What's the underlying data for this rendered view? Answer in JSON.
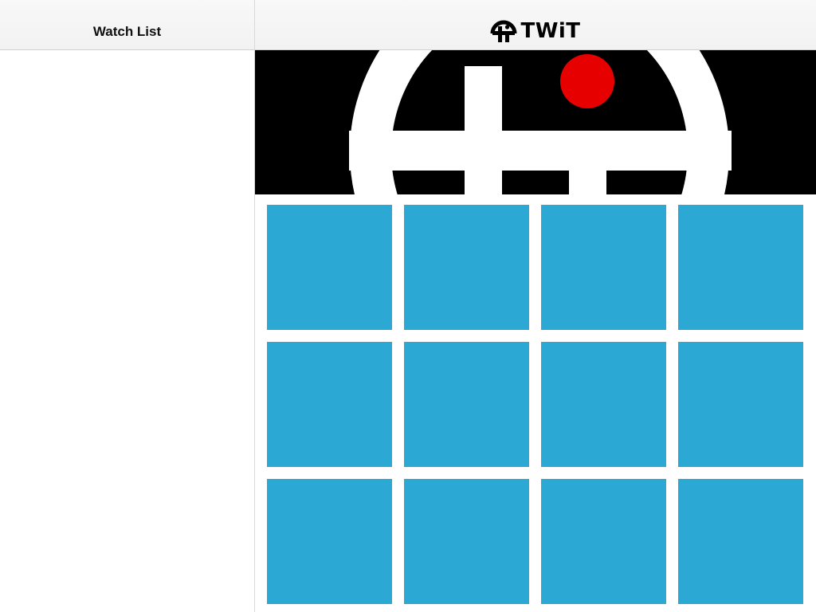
{
  "sidebar": {
    "title": "Watch List"
  },
  "header": {
    "brand_text": "TWiT",
    "brand_icon": "twit-logo-icon"
  },
  "hero": {
    "icon": "twit-logo-icon",
    "accent_color": "#e60000"
  },
  "grid": {
    "tile_color": "#2ba8d3",
    "rows": 3,
    "columns": 4
  }
}
